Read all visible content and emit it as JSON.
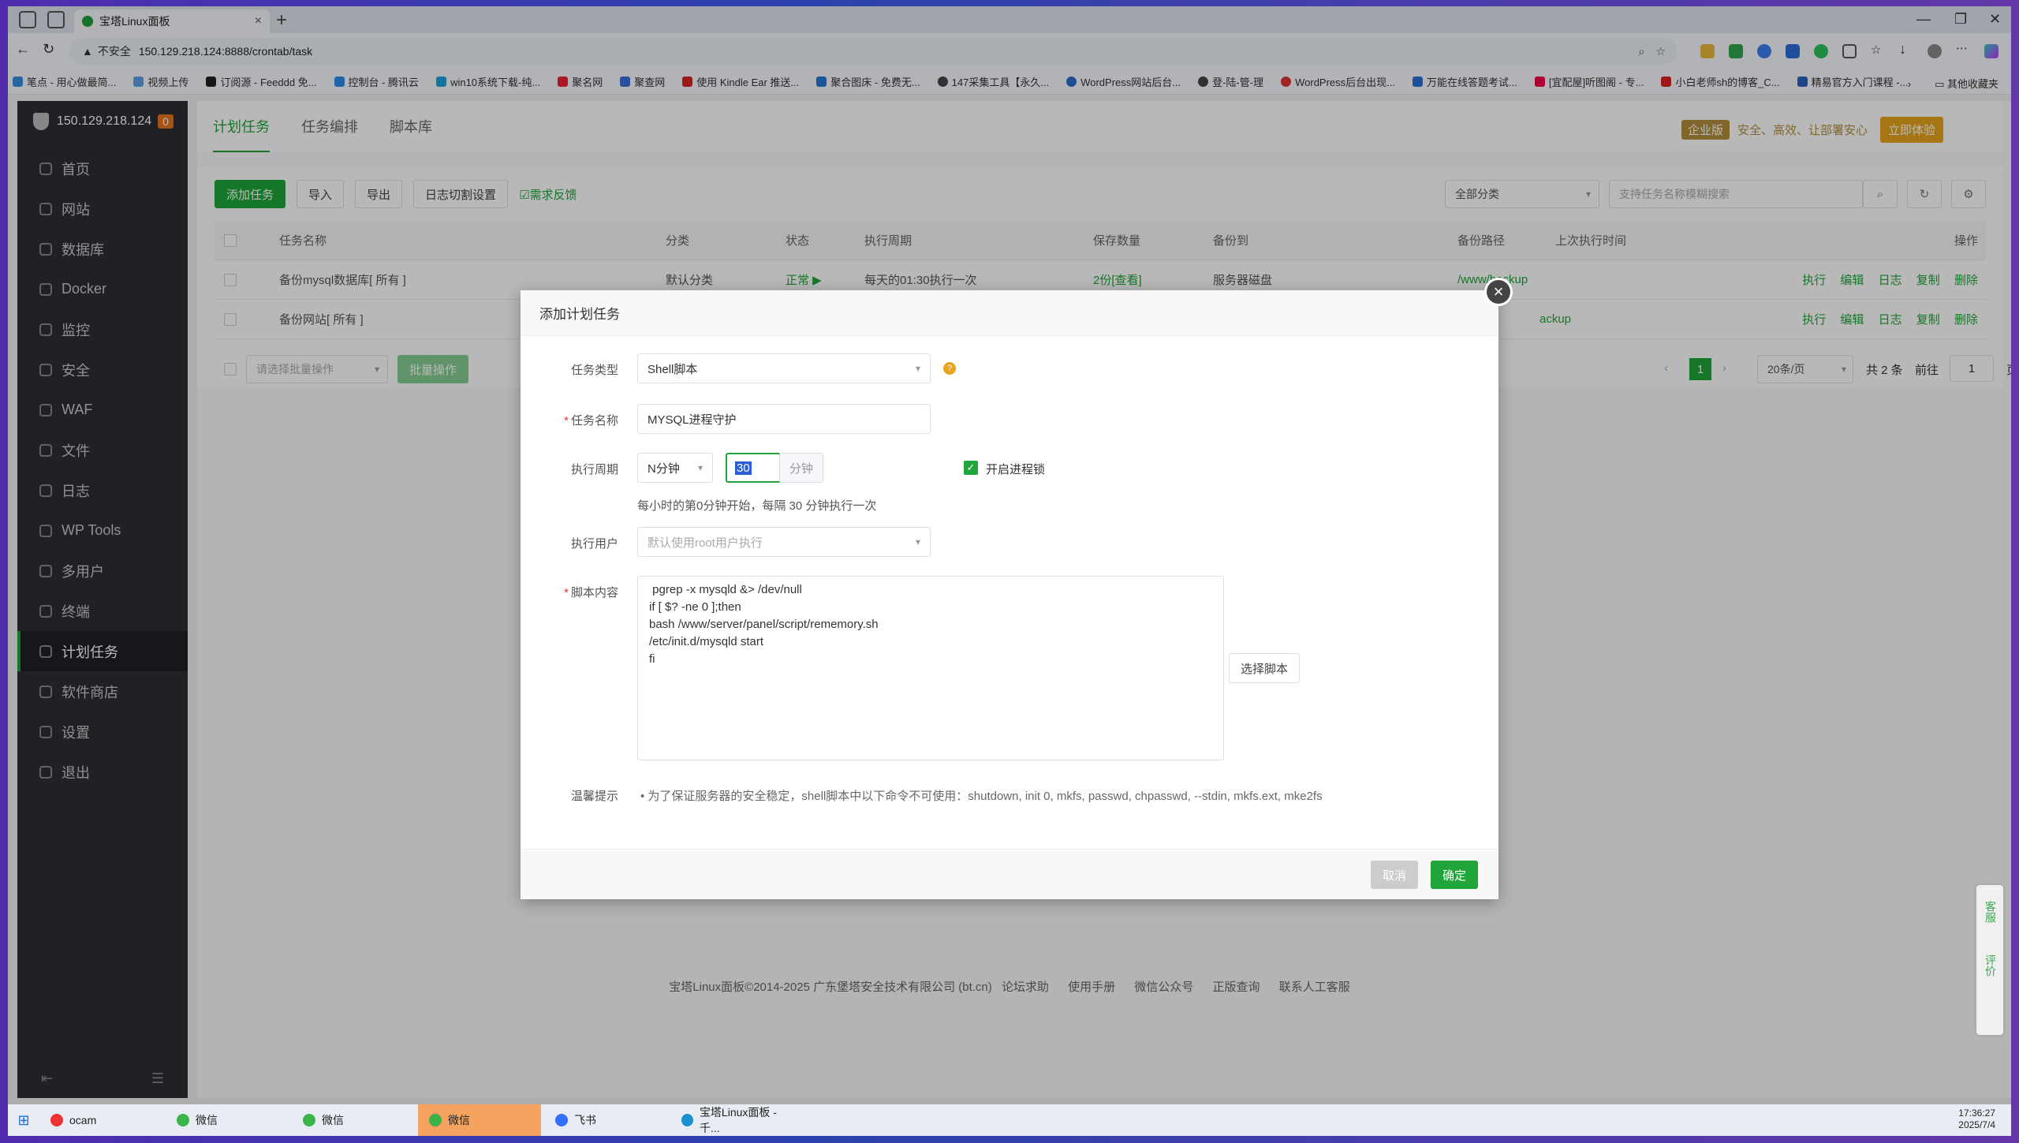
{
  "browser": {
    "tab_title": "宝塔Linux面板",
    "url_security": "不安全",
    "url": "150.129.218.124:8888/crontab/task",
    "bookmarks": [
      "笔点 - 用心做最简...",
      "视频上传",
      "订阅源 - Feeddd 免...",
      "控制台 - 腾讯云",
      "win10系统下载-纯...",
      "聚名网",
      "聚查网",
      "使用 Kindle Ear 推送...",
      "聚合图床 - 免费无...",
      "147采集工具【永久...",
      "WordPress网站后台...",
      "登-陆-管-理",
      "WordPress后台出现...",
      "万能在线答题考试...",
      "[宜配屋]听图阁 - 专...",
      "小白老师sh的博客_C...",
      "精易官方入门课程 -..."
    ],
    "bookmark_other": "其他收藏夹"
  },
  "sidebar": {
    "host": "150.129.218.124",
    "badge": "0",
    "items": [
      "首页",
      "网站",
      "数据库",
      "Docker",
      "监控",
      "安全",
      "WAF",
      "文件",
      "日志",
      "WP Tools",
      "多用户",
      "终端",
      "计划任务",
      "软件商店",
      "设置",
      "退出"
    ]
  },
  "topnav": {
    "tabs": [
      "计划任务",
      "任务编排",
      "脚本库"
    ],
    "enterprise": "企业版",
    "slogan": "安全、高效、让部署安心",
    "try": "立即体验"
  },
  "toolbar": {
    "add": "添加任务",
    "import": "导入",
    "export": "导出",
    "log_cut": "日志切割设置",
    "feedback": "需求反馈",
    "category": "全部分类",
    "search_placeholder": "支持任务名称模糊搜索"
  },
  "table": {
    "headers": [
      "任务名称",
      "分类",
      "状态",
      "执行周期",
      "保存数量",
      "备份到",
      "备份路径",
      "上次执行时间",
      "操作"
    ],
    "rows": [
      {
        "name": "备份mysql数据库[ 所有 ]",
        "category": "默认分类",
        "status": "正常 ▶",
        "cycle": "每天的01:30执行一次",
        "keep": "2份[查看]",
        "backup_to": "服务器磁盘",
        "path": "/www/backup"
      },
      {
        "name": "备份网站[ 所有 ]",
        "category": "",
        "status": "",
        "cycle": "",
        "keep": "",
        "backup_to": "",
        "path": "ackup"
      }
    ],
    "actions": [
      "执行",
      "编辑",
      "日志",
      "复制",
      "删除"
    ],
    "batch_placeholder": "请选择批量操作",
    "batch_btn": "批量操作",
    "page_current": "1",
    "page_size": "20条/页",
    "total": "共 2 条",
    "goto": "前往",
    "goto_value": "1",
    "page_unit": "页"
  },
  "modal": {
    "title": "添加计划任务",
    "task_type_label": "任务类型",
    "task_type_value": "Shell脚本",
    "task_name_label": "任务名称",
    "task_name_value": "MYSQL进程守护",
    "cycle_label": "执行周期",
    "cycle_type": "N分钟",
    "cycle_value": "30",
    "cycle_unit": "分钟",
    "lock_label": "开启进程锁",
    "cycle_desc": "每小时的第0分钟开始，每隔 30 分钟执行一次",
    "user_label": "执行用户",
    "user_placeholder": "默认使用root用户执行",
    "script_label": "脚本内容",
    "script_content": " pgrep -x mysqld &> /dev/null\nif [ $? -ne 0 ];then\nbash /www/server/panel/script/rememory.sh\n/etc/init.d/mysqld start\nfi",
    "choose_script": "选择脚本",
    "hint_label": "温馨提示",
    "hint_text": "为了保证服务器的安全稳定，shell脚本中以下命令不可使用：shutdown, init 0, mkfs, passwd, chpasswd, --stdin, mkfs.ext, mke2fs",
    "cancel": "取消",
    "confirm": "确定"
  },
  "side_float": [
    "客服",
    "评价"
  ],
  "footer": {
    "copyright": "宝塔Linux面板©2014-2025 广东堡塔安全技术有限公司 (bt.cn)",
    "links": [
      "论坛求助",
      "使用手册",
      "微信公众号",
      "正版查询",
      "联系人工客服"
    ]
  },
  "taskbar": {
    "items": [
      "ocam",
      "微信",
      "微信",
      "微信",
      "飞书",
      "宝塔Linux面板 - 千..."
    ],
    "time": "17:36:27",
    "date": "2025/7/4"
  }
}
